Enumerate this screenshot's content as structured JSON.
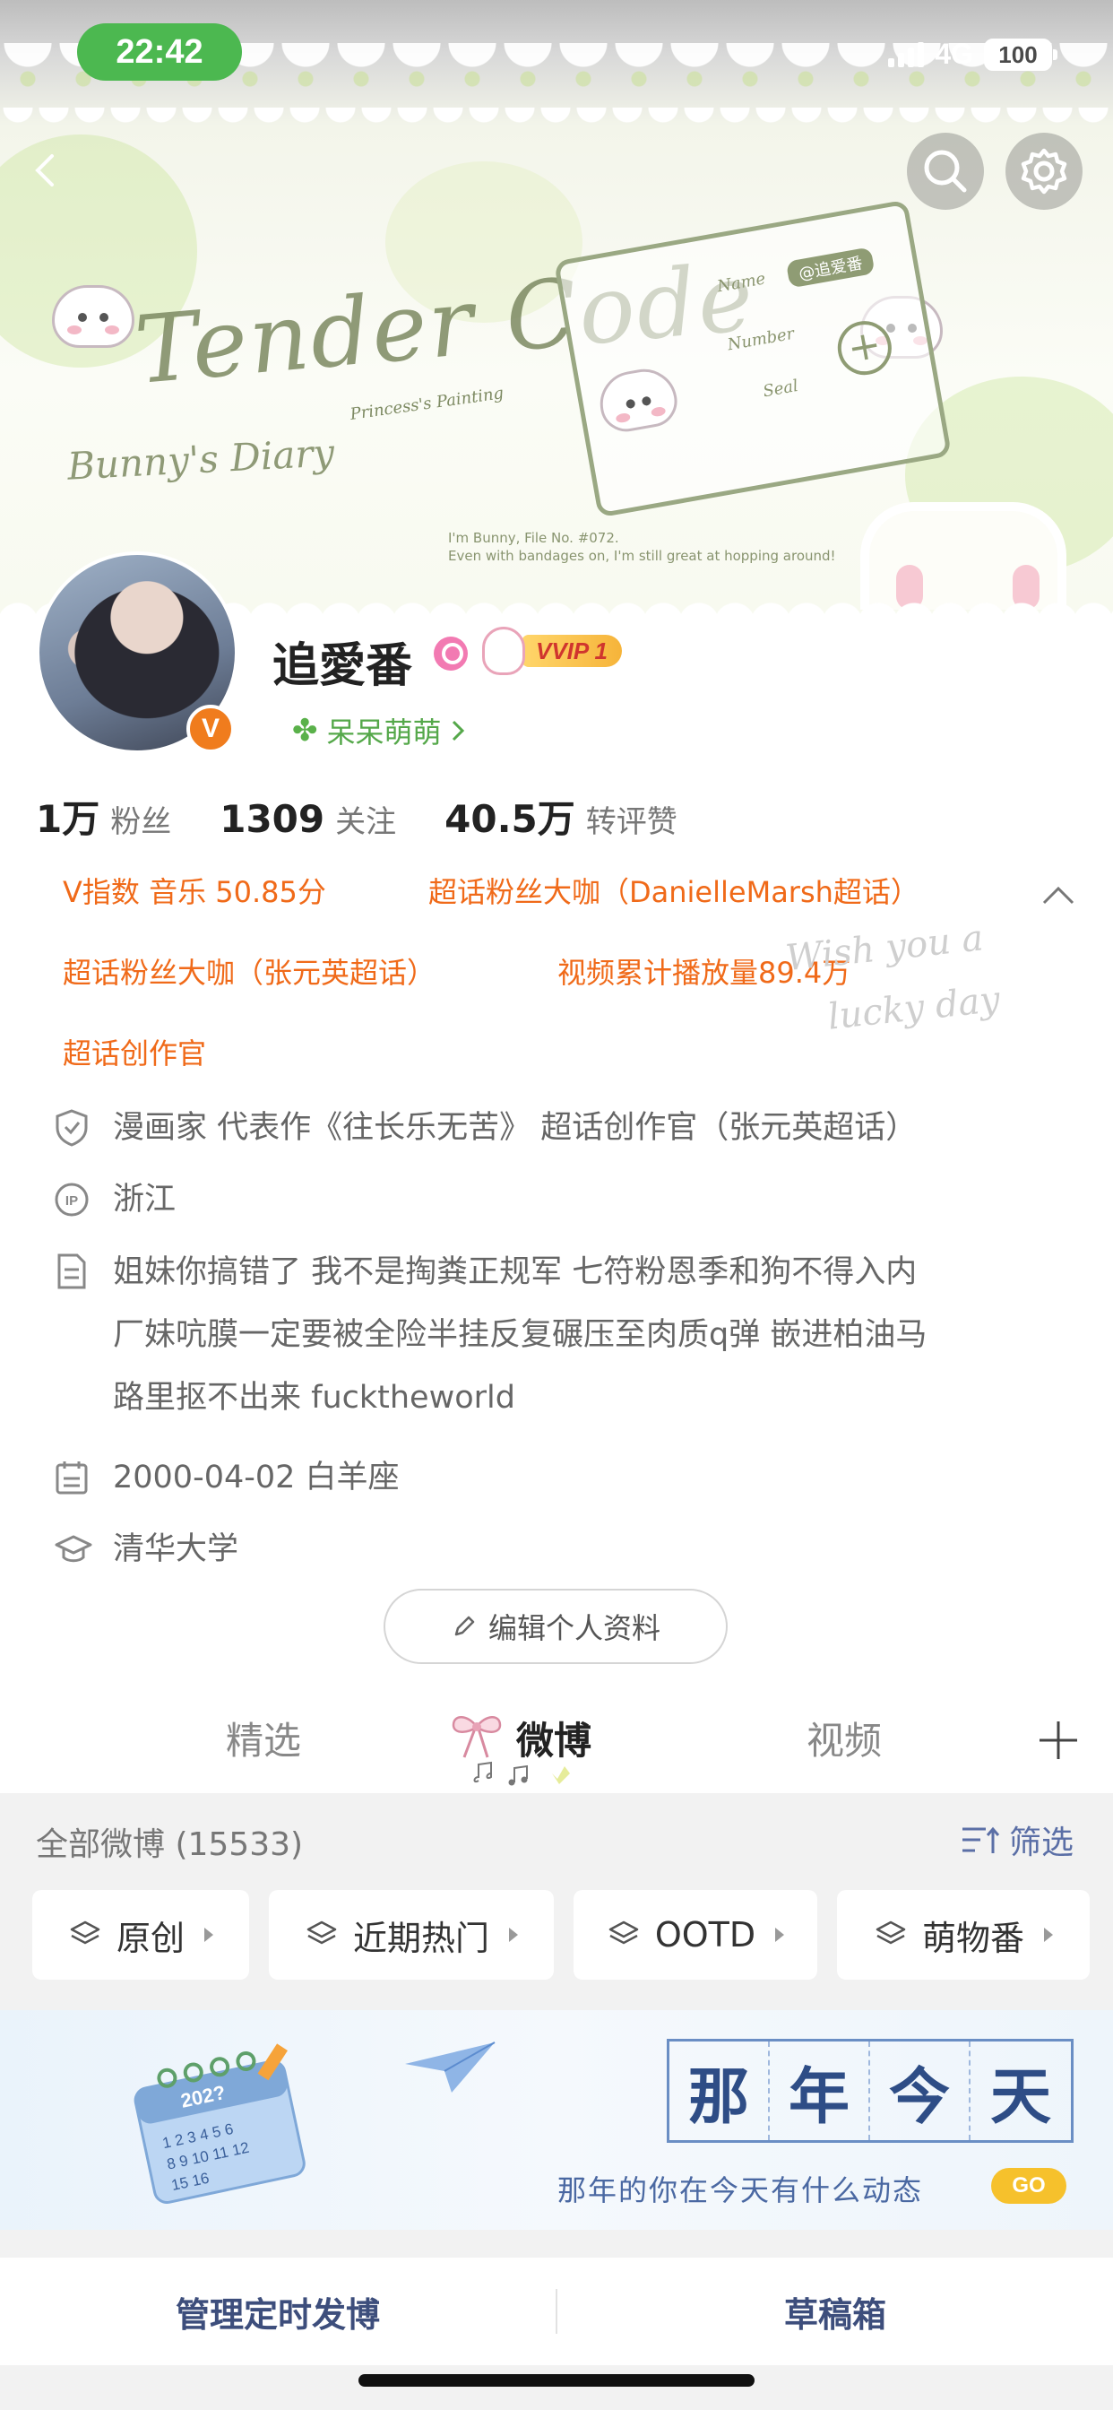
{
  "status_bar": {
    "time": "22:42",
    "network": "4G",
    "battery": "100"
  },
  "header": {
    "banner_title": "Tender Code",
    "banner_subtitle": "Bunny's Diary",
    "card_name_tag": "@追爱番",
    "card_labels": [
      "Name",
      "Number",
      "Seal"
    ],
    "banner_note_1": "I'm Bunny, File No. #072.",
    "banner_note_2": "Even with bandages on, I'm still great at hopping around!",
    "princess": "Princess's Painting",
    "lucky_1": "Wish you a",
    "lucky_2": "lucky day"
  },
  "profile": {
    "username": "追愛番",
    "vip_label": "VVIP 1",
    "fan_group": "呆呆萌萌",
    "stats": [
      {
        "value": "1万",
        "label": "粉丝"
      },
      {
        "value": "1309",
        "label": "关注"
      },
      {
        "value": "40.5万",
        "label": "转评赞"
      }
    ],
    "badges": [
      [
        "V指数 音乐 50.85分",
        "超话粉丝大咖（DanielleMarsh超话）"
      ],
      [
        "超话粉丝大咖（张元英超话）",
        "视频累计播放量89.4万"
      ],
      [
        "超话创作官"
      ]
    ],
    "info": {
      "verified": "漫画家 代表作《往长乐无苦》 超话创作官（张元英超话）",
      "location": "浙江",
      "bio_lines": [
        "姐妹你搞错了 我不是掏粪正规军 七符粉恩季和狗不得入内",
        "厂妹吭膜一定要被全险半挂反复碾压至肉质q弹 嵌进柏油马",
        "路里抠不出来 fucktheworld"
      ],
      "birthday": "2000-04-02 白羊座",
      "school": "清华大学"
    },
    "edit_button": "编辑个人资料"
  },
  "tabs": [
    {
      "label": "精选",
      "active": false
    },
    {
      "label": "微博",
      "active": true
    },
    {
      "label": "视频",
      "active": false
    }
  ],
  "feed": {
    "all_posts": "全部微博 (15533)",
    "filter": "筛选",
    "chips": [
      "原创",
      "近期热门",
      "OOTD",
      "萌物番"
    ],
    "memory": {
      "chars": [
        "那",
        "年",
        "今",
        "天"
      ],
      "subtitle": "那年的你在今天有什么动态",
      "go": "GO",
      "calendar_year": "202?",
      "calendar_days": "1 2 3 4 5 6 / 8 9 10 11 12 / 15 16"
    },
    "bottom_actions": [
      "管理定时发博",
      "草稿箱"
    ]
  },
  "colors": {
    "accent_orange": "#f06a19",
    "vip_gold": "#f6b43a",
    "fan_green": "#55a84a",
    "link_blue": "#5b6fa6"
  }
}
